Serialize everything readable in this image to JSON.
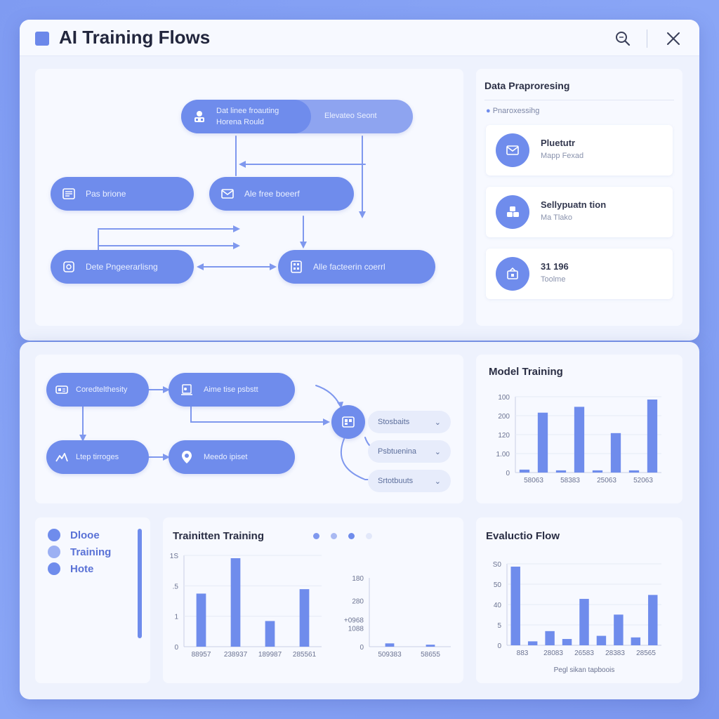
{
  "app": {
    "title": "AI Training Flows"
  },
  "flow_top": {
    "nodes": [
      {
        "label": "Dat linee froauting\nHorena Rould",
        "icon": "group-icon"
      },
      {
        "label": "Elevateo Seont",
        "icon": ""
      },
      {
        "label": "Pas brione",
        "icon": "document-icon"
      },
      {
        "label": "Ale free boeerf",
        "icon": "mail-icon"
      },
      {
        "label": "Dete Pngeerarlisng",
        "icon": "cube-icon"
      },
      {
        "label": "Alle facteerin coerrl",
        "icon": "grid-icon"
      }
    ]
  },
  "side_panel": {
    "title": "Data Praproresing",
    "subtitle": "Pnaroxessihg",
    "cards": [
      {
        "title": "Pluetutr",
        "subtitle": "Mapp Fexad",
        "icon": "mail-icon"
      },
      {
        "title": "Sellypuatn tion",
        "subtitle": "Ma Tlako",
        "icon": "cubes-icon"
      },
      {
        "title": "31 196",
        "subtitle": "Toolme",
        "icon": "box-icon"
      }
    ]
  },
  "flow_bottom": {
    "nodes": [
      {
        "label": "Coredtelthesity",
        "icon": "chip-icon"
      },
      {
        "label": "Aime tise psbstt",
        "icon": "flask-icon"
      },
      {
        "label": "Ltep tirroges",
        "icon": "runner-icon"
      },
      {
        "label": "Meedo ipiset",
        "icon": "location-pin-icon"
      }
    ],
    "dropdowns": [
      "Stosbaits",
      "Psbtuenina",
      "Srtotbuuts"
    ]
  },
  "legend": {
    "items": [
      {
        "label": "Dlooe",
        "color": "#6f8cec"
      },
      {
        "label": "Training",
        "color": "#9cb0f3"
      },
      {
        "label": "Hote",
        "color": "#6f8cec"
      }
    ]
  },
  "colors": {
    "accent": "#6f8cec",
    "bar": "#6f8cec"
  },
  "chart_data": [
    {
      "type": "bar",
      "title": "Model Training",
      "yticks": [
        "100",
        "200",
        "120",
        "1.00",
        "0"
      ],
      "xticks": [
        "58063",
        "58383",
        "25063",
        "52063"
      ],
      "values": [
        4,
        82,
        3,
        90,
        3,
        54,
        3,
        100
      ]
    },
    {
      "type": "bar",
      "title": "Trainitten Training",
      "yticks": [
        "1S",
        ".5",
        "1",
        "0"
      ],
      "xticks": [
        "88957",
        "238937",
        "189987",
        "285561"
      ],
      "values": [
        60,
        100,
        29,
        65
      ]
    },
    {
      "type": "bar",
      "title": "",
      "yticks": [
        "180",
        "280",
        "+0968\n1088",
        "0"
      ],
      "xticks": [
        "509383",
        "58655"
      ],
      "values": [
        5,
        3
      ]
    },
    {
      "type": "bar",
      "title": "Evaluctio Flow",
      "yticks": [
        "S0",
        "50",
        "40",
        "5",
        "0"
      ],
      "xticks": [
        "883",
        "28083",
        "26583",
        "28383",
        "28565"
      ],
      "values": [
        100,
        5,
        18,
        8,
        59,
        12,
        39,
        10,
        64
      ],
      "xlabel": "Pegl sikan tapboois"
    }
  ]
}
